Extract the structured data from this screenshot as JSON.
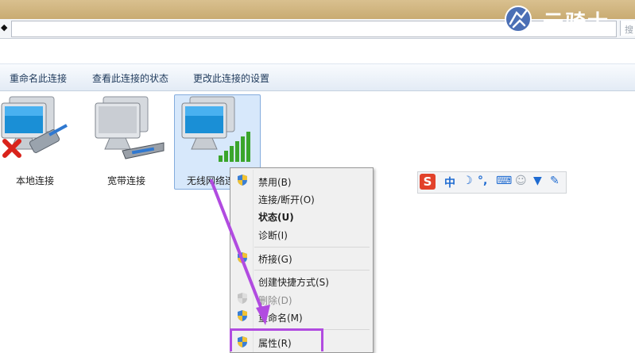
{
  "address_bar": {
    "back_glyph": "◆",
    "search_placeholder": "搜"
  },
  "watermark": {
    "text": "云骑士"
  },
  "toolbar": {
    "items": [
      {
        "label": "重命名此连接"
      },
      {
        "label": "查看此连接的状态"
      },
      {
        "label": "更改此连接的设置"
      }
    ]
  },
  "connections": [
    {
      "label": "本地连接",
      "status": "disconnected",
      "icon": "monitor-network-cable-icon"
    },
    {
      "label": "宽带连接",
      "status": "normal",
      "icon": "monitor-modem-icon"
    },
    {
      "label": "无线网络连接",
      "visible_label": "无线网络连",
      "status": "selected",
      "icon": "monitor-wireless-signal-icon"
    }
  ],
  "ime_toolbar": {
    "logo": "S",
    "mode": "中",
    "items": [
      "moon-icon",
      "punctuation-icon",
      "keyboard-icon",
      "user-icon",
      "shirt-icon",
      "wrench-icon"
    ],
    "punct": "°,"
  },
  "context_menu": {
    "items": [
      {
        "label": "禁用(B)",
        "icon": "shield-icon"
      },
      {
        "label": "连接/断开(O)"
      },
      {
        "label": "状态(U)",
        "bold": true
      },
      {
        "label": "诊断(I)"
      },
      {
        "label": "桥接(G)",
        "icon": "shield-icon"
      },
      {
        "label": "创建快捷方式(S)"
      },
      {
        "label": "删除(D)",
        "icon": "shield-icon",
        "disabled": true
      },
      {
        "label": "重命名(M)",
        "icon": "shield-icon"
      },
      {
        "label": "属性(R)",
        "icon": "shield-icon",
        "highlighted": true
      }
    ]
  },
  "colors": {
    "title_bar": "#c9ab72",
    "toolbar_text": "#1e395b",
    "selection": "#d7e8fb",
    "annotation": "#b14be0",
    "ime_red": "#e2422b",
    "ime_blue": "#1f6bd1"
  }
}
